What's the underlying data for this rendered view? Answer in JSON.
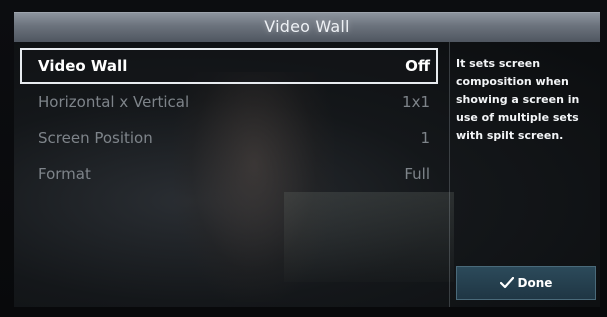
{
  "header": {
    "title": "Video Wall"
  },
  "menu": {
    "items": [
      {
        "label": "Video Wall",
        "value": "Off",
        "selected": true
      },
      {
        "label": "Horizontal x Vertical",
        "value": "1x1"
      },
      {
        "label": "Screen Position",
        "value": "1"
      },
      {
        "label": "Format",
        "value": "Full"
      }
    ]
  },
  "help": {
    "text": "It sets screen composition when showing a screen in use of multiple sets with spilt screen."
  },
  "done_button": {
    "label": "Done",
    "icon": "checkmark-icon"
  },
  "colors": {
    "selection_border": "#e8ecf0",
    "done_bg": "#264150",
    "title_bar": "#7a818b"
  }
}
